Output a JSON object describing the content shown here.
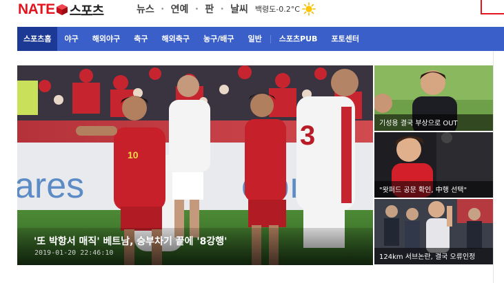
{
  "brand": {
    "nate": "NATE",
    "section": "스포츠"
  },
  "topnav": {
    "links": [
      "뉴스",
      "연예",
      "판",
      "날씨"
    ],
    "weather_text": "백령도-0.2°C",
    "weather_icon": "sun-icon"
  },
  "gnb": {
    "items": [
      "스포츠홈",
      "야구",
      "해외야구",
      "축구",
      "해외축구",
      "농구/배구",
      "일반",
      "스포츠PUB",
      "포토센터"
    ],
    "active": "스포츠홈"
  },
  "headline": {
    "title": "'또 박항서 매직' 베트남, 승부차기 끝에 '8강행'",
    "date": "2019-01-20 22:46:10"
  },
  "side_news": [
    {
      "title": "기성용 결국 부상으로 OUT"
    },
    {
      "title": "\"왓퍼드 공문 확인, 中행 선택\""
    },
    {
      "title": "124km 서브논란, 결국 오류인정"
    }
  ],
  "colors": {
    "brand_red": "#e4141e",
    "gnb_blue": "#3a5fc8",
    "gnb_active": "#1c3a95"
  }
}
